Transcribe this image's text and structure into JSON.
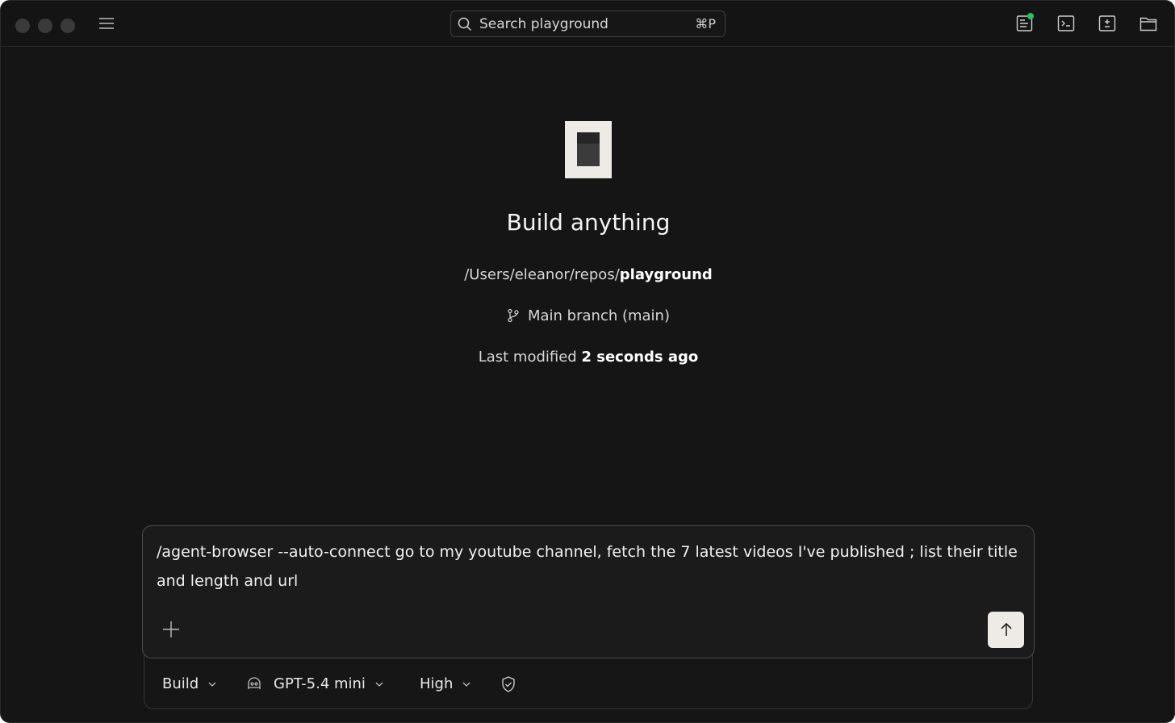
{
  "window": {
    "traffic_lights": [
      "close",
      "minimize",
      "maximize"
    ]
  },
  "toolbar": {
    "menu_icon": "hamburger-menu-icon",
    "search": {
      "placeholder": "Search playground",
      "shortcut": "⌘P"
    },
    "right_icons": [
      "review-panel-icon",
      "terminal-icon",
      "diff-icon",
      "folder-icon"
    ],
    "status_color": "#22c55e"
  },
  "hero": {
    "logo_icon": "app-logo",
    "title": "Build anything",
    "path_prefix": "/Users/eleanor/repos/",
    "path_project": "playground",
    "branch_label": "Main branch (main)",
    "modified_prefix": "Last modified",
    "modified_value": "2 seconds ago"
  },
  "composer": {
    "text": "/agent-browser --auto-connect go to my youtube channel, fetch the 7 latest videos I've published ; list their title and length and url",
    "attach_icon": "plus-icon",
    "send_icon": "arrow-up-icon"
  },
  "footer": {
    "mode": "Build",
    "model": "GPT-5.4 mini",
    "effort": "High",
    "permission_icon": "shield-check-icon"
  }
}
